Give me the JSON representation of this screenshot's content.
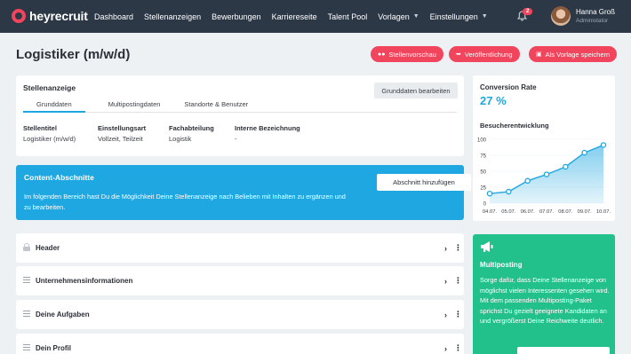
{
  "app": {
    "logo": "heyrecruit"
  },
  "nav": {
    "items": [
      "Dashboard",
      "Stellenanzeigen",
      "Bewerbungen",
      "Karriereseite",
      "Talent Pool",
      "Vorlagen",
      "Einstellungen"
    ],
    "notifications": "2"
  },
  "user": {
    "name": "Hanna Groß",
    "role": "Administator"
  },
  "page": {
    "title": "Logistiker (m/w/d)"
  },
  "header_buttons": {
    "preview": "Stellenvorschau",
    "publish": "Veröffentlichung",
    "template": "Als Vorlage speichern"
  },
  "stellenanzeige": {
    "title": "Stellenanzeige",
    "edit_button": "Grunddaten bearbeiten",
    "tabs": [
      "Grunddaten",
      "Multipostingdaten",
      "Standorte & Benutzer"
    ],
    "fields": [
      {
        "label": "Stellentitel",
        "value": "Logistiker (m/w/d)"
      },
      {
        "label": "Einstellungsart",
        "value": "Vollzeit, Teilzeit"
      },
      {
        "label": "Fachabteilung",
        "value": "Logistik"
      },
      {
        "label": "Interne Bezeichnung",
        "value": "-"
      }
    ]
  },
  "content": {
    "title": "Content-Abschnitte",
    "text": "Im folgenden Bereich hast Du die Möglichkeit Deine Stellenanzeige nach Belieben mit Inhalten zu ergänzen und zu bearbeiten.",
    "add_button": "Abschnitt hinzufügen"
  },
  "sections": [
    "Header",
    "Unternehmensinformationen",
    "Deine Aufgaben",
    "Dein Profil"
  ],
  "conversion": {
    "title": "Conversion Rate",
    "value": "27 %",
    "chart_title": "Besucherentwicklung"
  },
  "chart_data": {
    "type": "area",
    "title": "Besucherentwicklung",
    "categories": [
      "04.07.",
      "05.07.",
      "06.07.",
      "07.07.",
      "08.07.",
      "09.07.",
      "10.07."
    ],
    "values": [
      15,
      18,
      35,
      45,
      57,
      79,
      91
    ],
    "ylim": [
      0,
      100
    ],
    "yticks": [
      0,
      25,
      50,
      75,
      100
    ],
    "color": "#1ea7e1"
  },
  "multiposting": {
    "title": "Multiposting",
    "text": "Sorge dafür, dass Deine Stellenanzeige von möglichst vielen Interessenten gesehen wird. Mit dem passenden Multiposting-Paket sprichst Du gezielt geeignete Kandidaten an und vergrößerst Deine Reichweite deutlich."
  },
  "colors": {
    "nav": "#2d3847",
    "accent": "#f0455c",
    "blue": "#1ea7e1",
    "green": "#22c08a"
  }
}
